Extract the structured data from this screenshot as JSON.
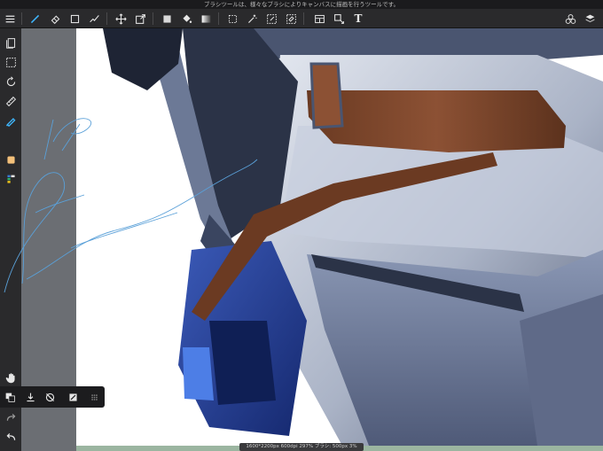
{
  "tip_bar": {
    "text": "ブラシツールは、様々なブラシによりキャンバスに描画を行うツールです。"
  },
  "toolbar": {
    "items": [
      {
        "name": "menu-icon"
      },
      {
        "name": "brush-icon",
        "active": true
      },
      {
        "name": "eraser-icon"
      },
      {
        "name": "square-icon"
      },
      {
        "name": "blur-icon"
      },
      {
        "name": "move-icon"
      },
      {
        "name": "transform-icon"
      },
      {
        "name": "fill-color-icon"
      },
      {
        "name": "bucket-icon"
      },
      {
        "name": "gradient-icon"
      },
      {
        "name": "select-rect-icon"
      },
      {
        "name": "magic-wand-icon"
      },
      {
        "name": "select-pen-icon"
      },
      {
        "name": "select-eraser-icon"
      },
      {
        "name": "frame-divider-icon"
      },
      {
        "name": "operation-icon"
      },
      {
        "name": "text-icon",
        "label": "T"
      },
      {
        "name": "material-icon"
      },
      {
        "name": "layers-icon"
      }
    ]
  },
  "sidebar": {
    "items": [
      {
        "name": "pages-icon"
      },
      {
        "name": "selection-icon"
      },
      {
        "name": "rotate-icon"
      },
      {
        "name": "ruler-icon"
      },
      {
        "name": "pen-icon"
      },
      {
        "name": "color-swatch-icon"
      },
      {
        "name": "palette-icon"
      },
      {
        "name": "hand-icon"
      },
      {
        "name": "redo-icon"
      },
      {
        "name": "undo-icon"
      }
    ]
  },
  "bottom_panel": {
    "items": [
      {
        "name": "color-swap-icon"
      },
      {
        "name": "import-icon"
      },
      {
        "name": "no-snap-icon"
      },
      {
        "name": "fill-mode-icon"
      },
      {
        "name": "grid-icon"
      }
    ]
  },
  "status_bar": {
    "text": "1600*2200px 600dpi 297% ブラシ: 500px 3%"
  },
  "colors": {
    "accent": "#3fb8ff",
    "toolbar_bg": "#2a2a2c",
    "canvas_bg": "#ffffff",
    "gutter": "#6b6e73"
  }
}
